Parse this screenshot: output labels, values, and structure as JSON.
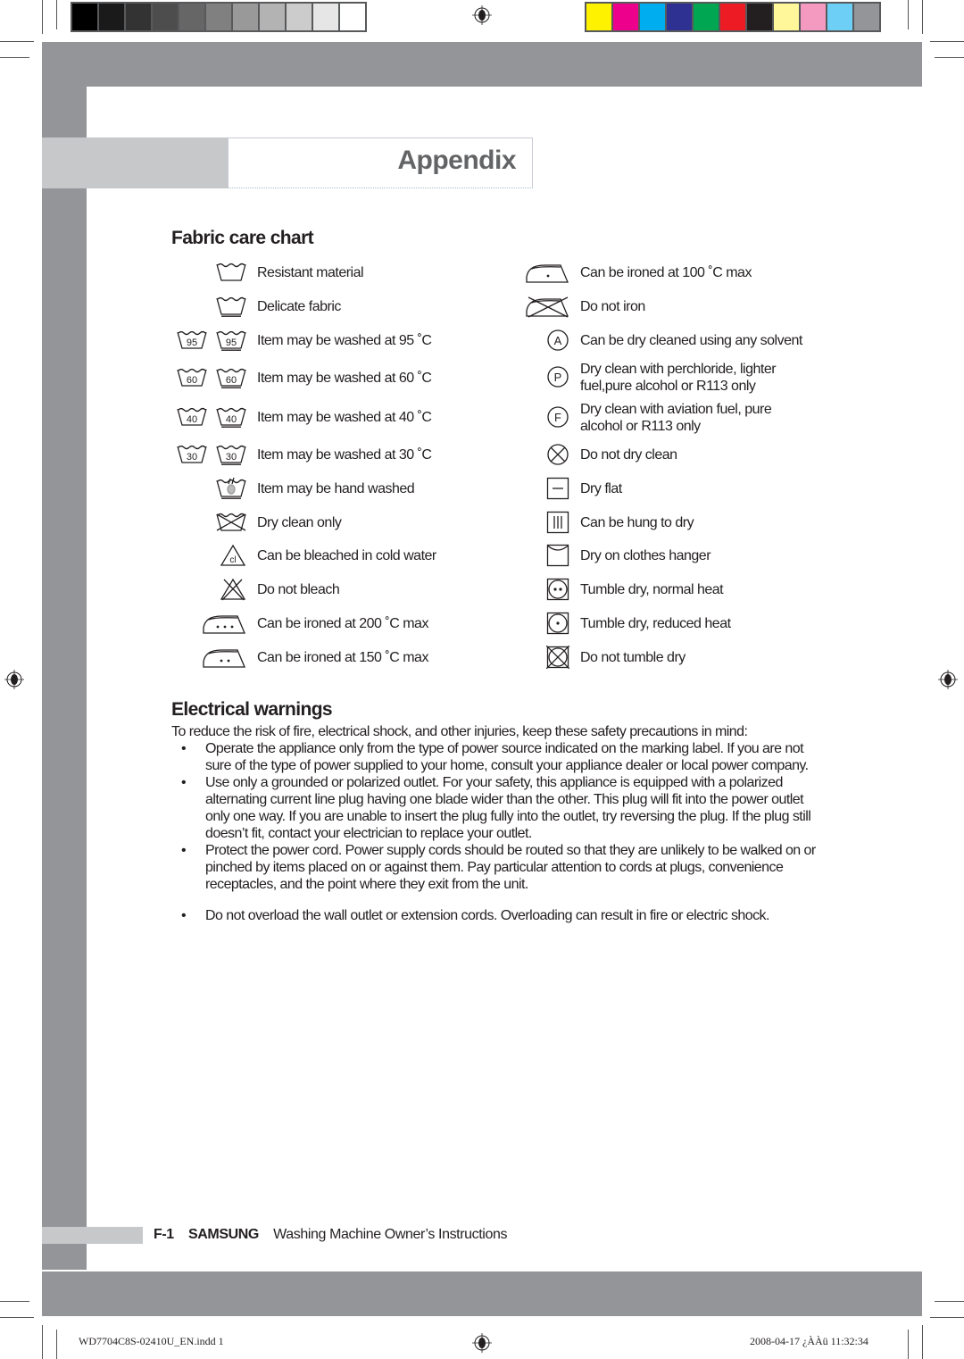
{
  "color_bars": {
    "grayscale": [
      "#000000",
      "#1a1a1a",
      "#333333",
      "#4d4d4d",
      "#666666",
      "#808080",
      "#999999",
      "#b3b3b3",
      "#cccccc",
      "#e6e6e6",
      "#ffffff"
    ],
    "process": [
      "#fff200",
      "#ec008c",
      "#00aeef",
      "#2e3192",
      "#00a651",
      "#ed1c24",
      "#231f20",
      "#fff799",
      "#f49ac1",
      "#6dcff6",
      "#939598"
    ]
  },
  "header": {
    "title": "Appendix"
  },
  "fabric_care": {
    "heading": "Fabric care chart",
    "left": [
      {
        "icon": "washtub-resistant-icon",
        "label": "Resistant material"
      },
      {
        "icon": "washtub-delicate-icon",
        "label": "Delicate fabric"
      },
      {
        "icon": "wash-95-icon",
        "temp": "95",
        "label": "Item may be washed at 95 ˚C"
      },
      {
        "icon": "wash-60-icon",
        "temp": "60",
        "label": "Item may be washed at 60 ˚C"
      },
      {
        "icon": "wash-40-icon",
        "temp": "40",
        "label": "Item may be washed at 40 ˚C"
      },
      {
        "icon": "wash-30-icon",
        "temp": "30",
        "label": "Item may be washed at 30 ˚C"
      },
      {
        "icon": "hand-wash-icon",
        "label": "Item may be hand washed"
      },
      {
        "icon": "do-not-wash-icon",
        "label": "Dry clean only"
      },
      {
        "icon": "bleach-cold-icon",
        "glyph": "cl",
        "label": "Can be bleached in cold water"
      },
      {
        "icon": "do-not-bleach-icon",
        "label": "Do not bleach"
      },
      {
        "icon": "iron-3-dots-icon",
        "label": "Can be ironed at 200 ˚C max"
      },
      {
        "icon": "iron-2-dots-icon",
        "label": "Can be ironed at 150 ˚C max"
      }
    ],
    "right": [
      {
        "icon": "iron-1-dot-icon",
        "label": "Can be ironed at 100 ˚C max"
      },
      {
        "icon": "do-not-iron-icon",
        "label": "Do not iron"
      },
      {
        "icon": "dry-clean-a-icon",
        "glyph": "A",
        "label": "Can be dry cleaned using any solvent"
      },
      {
        "icon": "dry-clean-p-icon",
        "glyph": "P",
        "label": "Dry clean with perchloride, lighter",
        "label2": "fuel,pure alcohol or R113 only"
      },
      {
        "icon": "dry-clean-f-icon",
        "glyph": "F",
        "label": "Dry clean with aviation fuel, pure",
        "label2": "alcohol or R113 only"
      },
      {
        "icon": "do-not-dry-clean-icon",
        "label": "Do not dry clean"
      },
      {
        "icon": "dry-flat-icon",
        "label": "Dry flat"
      },
      {
        "icon": "drip-dry-icon",
        "label": "Can be hung to dry"
      },
      {
        "icon": "line-dry-icon",
        "label": "Dry on clothes hanger"
      },
      {
        "icon": "tumble-normal-icon",
        "label": "Tumble dry, normal heat"
      },
      {
        "icon": "tumble-low-icon",
        "label": "Tumble dry, reduced heat"
      },
      {
        "icon": "do-not-tumble-icon",
        "label": "Do not tumble dry"
      }
    ]
  },
  "electrical": {
    "heading": "Electrical warnings",
    "intro": "To reduce the risk of fire, electrical shock, and other injuries, keep these safety precautions in mind:",
    "bullets": [
      "Operate the appliance only from the type of power source indicated on the marking label. If you are not sure of the type of power supplied to your home, consult your appliance dealer or local power company.",
      "Use only a grounded or polarized outlet. For your safety, this appliance is equipped with a polarized alternating current line plug having one blade wider than the other. This plug will fit into the power outlet only one way. If you are unable to insert the plug fully into the outlet, try reversing the plug. If the plug still doesn’t fit, contact your electrician to replace your outlet.",
      "Protect the power cord. Power supply cords should be routed so that they are unlikely to be walked on or pinched by items placed on or against them. Pay particular attention to cords at plugs, convenience receptacles, and the point where they exit from the unit.",
      "Do not overload the wall outlet or extension cords. Overloading can result in fire or electric shock."
    ]
  },
  "footer": {
    "page": "F-1",
    "brand": "SAMSUNG",
    "doc_title": "Washing Machine Owner’s Instructions"
  },
  "slug": {
    "file": "WD7704C8S-02410U_EN.indd   1",
    "timestamp": "2008-04-17   ¿ÀÀü 11:32:34"
  }
}
